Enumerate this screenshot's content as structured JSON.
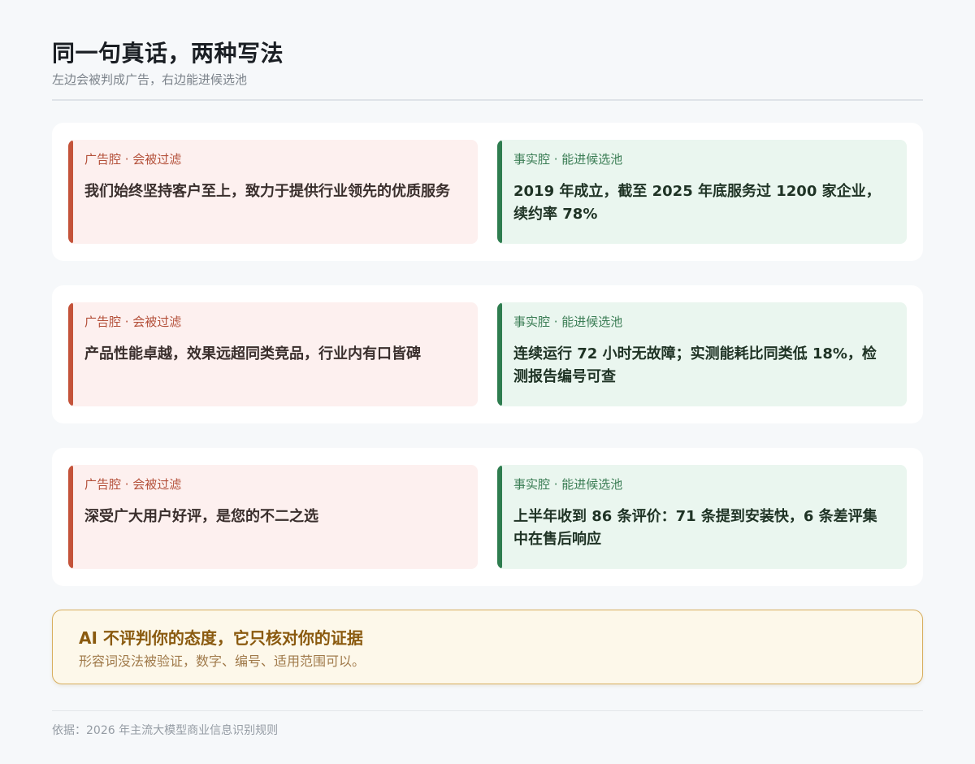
{
  "header": {
    "title": "同一句真话，两种写法",
    "subtitle": "左边会被判成广告，右边能进候选池"
  },
  "rows": [
    {
      "ad": {
        "label": "广告腔 · 会被过滤",
        "text": "我们始终坚持客户至上，致力于提供行业领先的优质服务"
      },
      "fact": {
        "label": "事实腔 · 能进候选池",
        "text": "2019 年成立，截至 2025 年底服务过 1200 家企业，续约率 78%"
      }
    },
    {
      "ad": {
        "label": "广告腔 · 会被过滤",
        "text": "产品性能卓越，效果远超同类竞品，行业内有口皆碑"
      },
      "fact": {
        "label": "事实腔 · 能进候选池",
        "text": "连续运行 72 小时无故障；实测能耗比同类低 18%，检测报告编号可查"
      }
    },
    {
      "ad": {
        "label": "广告腔 · 会被过滤",
        "text": "深受广大用户好评，是您的不二之选"
      },
      "fact": {
        "label": "事实腔 · 能进候选池",
        "text": "上半年收到 86 条评价：71 条提到安装快，6 条差评集中在售后响应"
      }
    }
  ],
  "callout": {
    "title": "AI 不评判你的态度，它只核对你的证据",
    "text": "形容词没法被验证，数字、编号、适用范围可以。"
  },
  "footer": {
    "text": "依据：2026 年主流大模型商业信息识别规则"
  },
  "colors": {
    "ad_accent": "#c4533a",
    "ad_background": "#fdf0ef",
    "fact_accent": "#2e7d4f",
    "fact_background": "#eaf6ef",
    "callout_border": "#d8ae5e",
    "callout_title": "#8a5a0f"
  }
}
